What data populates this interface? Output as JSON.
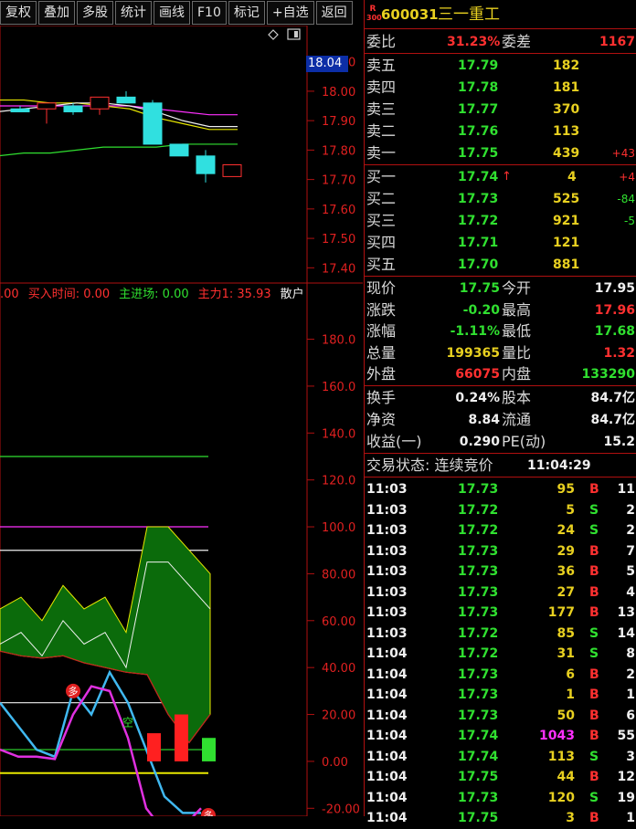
{
  "toolbar": {
    "buttons": [
      "复权",
      "叠加",
      "多股",
      "统计",
      "画线",
      "F10",
      "标记",
      "+自选",
      "返回"
    ]
  },
  "chart": {
    "price_axis": [
      "18.10",
      "18.00",
      "17.90",
      "17.80",
      "17.70",
      "17.60",
      "17.50",
      "17.40"
    ],
    "current_price_tag": "18.04",
    "indicator_axis": [
      "180.0",
      "160.0",
      "140.0",
      "120.0",
      "100.0",
      "80.00",
      "60.00",
      "40.00",
      "20.00",
      "0.00",
      "-20.00"
    ],
    "legend": [
      {
        "text": ".00",
        "color": "#ff3030"
      },
      {
        "text": "买入时间: 0.00",
        "color": "#ff3030"
      },
      {
        "text": "主进场: 0.00",
        "color": "#30e030"
      },
      {
        "text": "主力1: 35.93",
        "color": "#ff3030"
      },
      {
        "text": "散户",
        "color": "#f0f0f0"
      }
    ],
    "markers": {
      "duo": "多",
      "kong": "空"
    },
    "icons": [
      "diamond-icon",
      "window-icon"
    ]
  },
  "chart_data": {
    "type": "candlestick",
    "price_ylim": [
      17.37,
      18.13
    ],
    "candles": [
      {
        "open": 17.94,
        "close": 17.93,
        "high": 17.95,
        "low": 17.93,
        "color": "#30e0e0"
      },
      {
        "open": 17.94,
        "close": 17.96,
        "high": 17.96,
        "low": 17.89,
        "color": "#ff3030"
      },
      {
        "open": 17.95,
        "close": 17.93,
        "high": 17.96,
        "low": 17.92,
        "color": "#30e0e0"
      },
      {
        "open": 17.94,
        "close": 17.98,
        "high": 17.98,
        "low": 17.92,
        "color": "#ff3030"
      },
      {
        "open": 17.98,
        "close": 17.96,
        "high": 18.0,
        "low": 17.96,
        "color": "#30e0e0"
      },
      {
        "open": 17.96,
        "close": 17.82,
        "high": 17.97,
        "low": 17.82,
        "color": "#30e0e0"
      },
      {
        "open": 17.82,
        "close": 17.78,
        "high": 17.82,
        "low": 17.78,
        "color": "#30e0e0"
      },
      {
        "open": 17.78,
        "close": 17.72,
        "high": 17.8,
        "low": 17.69,
        "color": "#30e0e0"
      },
      {
        "open": 17.71,
        "close": 17.75,
        "high": 17.75,
        "low": 17.71,
        "color": "#ff3030"
      }
    ],
    "ma_lines": [
      {
        "color": "#ff30ff",
        "values": [
          17.95,
          17.95,
          17.95,
          17.95,
          17.95,
          17.95,
          17.94,
          17.93,
          17.92
        ]
      },
      {
        "color": "#e8e800",
        "values": [
          17.97,
          17.97,
          17.96,
          17.96,
          17.95,
          17.94,
          17.91,
          17.89,
          17.87
        ]
      },
      {
        "color": "#30e030",
        "values": [
          17.78,
          17.79,
          17.79,
          17.8,
          17.81,
          17.81,
          17.81,
          17.82,
          17.82
        ]
      },
      {
        "color": "#f0f0f0",
        "values": [
          17.93,
          17.94,
          17.95,
          17.96,
          17.96,
          17.95,
          17.93,
          17.9,
          17.88
        ]
      }
    ],
    "indicator_ylim": [
      -23,
      195
    ],
    "indicator_hlines": [
      {
        "value": 130,
        "color": "#30e030"
      },
      {
        "value": 100,
        "color": "#ff30ff"
      },
      {
        "value": 90,
        "color": "#f0f0f0"
      },
      {
        "value": 50,
        "color": "#e8e800"
      },
      {
        "value": 25,
        "color": "#f0f0f0"
      },
      {
        "value": 5,
        "color": "#30e030"
      },
      {
        "value": -5,
        "color": "#e8e800"
      }
    ],
    "area_upper": [
      65,
      70,
      60,
      75,
      65,
      70,
      55,
      100,
      100,
      90,
      80
    ],
    "area_lower": [
      47,
      45,
      44,
      45,
      42,
      40,
      38,
      37,
      20,
      8,
      20
    ],
    "cyan_line": [
      25,
      15,
      5,
      2,
      30,
      20,
      38,
      25,
      5,
      -15,
      -22,
      -22
    ],
    "magenta_line": [
      5,
      2,
      2,
      1,
      20,
      32,
      30,
      10,
      -20,
      -30,
      -28,
      -20
    ],
    "bars": [
      {
        "value": 12,
        "color": "#ff2020"
      },
      {
        "value": 20,
        "color": "#ff2020"
      },
      {
        "value": 10,
        "color": "#30e030"
      }
    ]
  },
  "quote": {
    "code": "600031",
    "name": "三一重工",
    "badge_top": "R",
    "badge_bottom": "300",
    "weibi_label": "委比",
    "weibi": "31.23%",
    "weicha_label": "委差",
    "weicha": "1167",
    "sells": [
      {
        "label": "卖五",
        "price": "17.79",
        "vol": "182",
        "chg": ""
      },
      {
        "label": "卖四",
        "price": "17.78",
        "vol": "181",
        "chg": ""
      },
      {
        "label": "卖三",
        "price": "17.77",
        "vol": "370",
        "chg": ""
      },
      {
        "label": "卖二",
        "price": "17.76",
        "vol": "113",
        "chg": ""
      },
      {
        "label": "卖一",
        "price": "17.75",
        "vol": "439",
        "chg": "+43"
      }
    ],
    "buys": [
      {
        "label": "买一",
        "price": "17.74",
        "vol": "4",
        "chg": "+4",
        "arrow": "↑"
      },
      {
        "label": "买二",
        "price": "17.73",
        "vol": "525",
        "chg": "-84",
        "arrow": ""
      },
      {
        "label": "买三",
        "price": "17.72",
        "vol": "921",
        "chg": "-5",
        "arrow": ""
      },
      {
        "label": "买四",
        "price": "17.71",
        "vol": "121",
        "chg": "",
        "arrow": ""
      },
      {
        "label": "买五",
        "price": "17.70",
        "vol": "881",
        "chg": "",
        "arrow": ""
      }
    ],
    "stats": [
      {
        "l1": "现价",
        "v1": "17.75",
        "c1": "grn",
        "l2": "今开",
        "v2": "17.95",
        "c2": "wht"
      },
      {
        "l1": "涨跌",
        "v1": "-0.20",
        "c1": "grn",
        "l2": "最高",
        "v2": "17.96",
        "c2": "red"
      },
      {
        "l1": "涨幅",
        "v1": "-1.11%",
        "c1": "grn",
        "l2": "最低",
        "v2": "17.68",
        "c2": "grn"
      },
      {
        "l1": "总量",
        "v1": "199365",
        "c1": "ylw",
        "l2": "量比",
        "v2": "1.32",
        "c2": "red"
      },
      {
        "l1": "外盘",
        "v1": "66075",
        "c1": "red",
        "l2": "内盘",
        "v2": "133290",
        "c2": "grn"
      }
    ],
    "fund": [
      {
        "l1": "换手",
        "v1": "0.24%",
        "l2": "股本",
        "v2": "84.7亿"
      },
      {
        "l1": "净资",
        "v1": "8.84",
        "l2": "流通",
        "v2": "84.7亿"
      },
      {
        "l1": "收益(一)",
        "v1": "0.290",
        "l2": "PE(动)",
        "v2": "15.2"
      }
    ],
    "status_label": "交易状态: 连续竞价",
    "status_time": "11:04:29"
  },
  "ticks": [
    {
      "t": "11:03",
      "p": "17.73",
      "v": "95",
      "s": "B",
      "n": "11"
    },
    {
      "t": "11:03",
      "p": "17.72",
      "v": "5",
      "s": "S",
      "n": "2"
    },
    {
      "t": "11:03",
      "p": "17.72",
      "v": "24",
      "s": "S",
      "n": "2"
    },
    {
      "t": "11:03",
      "p": "17.73",
      "v": "29",
      "s": "B",
      "n": "7"
    },
    {
      "t": "11:03",
      "p": "17.73",
      "v": "36",
      "s": "B",
      "n": "5"
    },
    {
      "t": "11:03",
      "p": "17.73",
      "v": "27",
      "s": "B",
      "n": "4"
    },
    {
      "t": "11:03",
      "p": "17.73",
      "v": "177",
      "s": "B",
      "n": "13"
    },
    {
      "t": "11:03",
      "p": "17.72",
      "v": "85",
      "s": "S",
      "n": "14"
    },
    {
      "t": "11:04",
      "p": "17.72",
      "v": "31",
      "s": "S",
      "n": "8"
    },
    {
      "t": "11:04",
      "p": "17.73",
      "v": "6",
      "s": "B",
      "n": "2"
    },
    {
      "t": "11:04",
      "p": "17.73",
      "v": "1",
      "s": "B",
      "n": "1"
    },
    {
      "t": "11:04",
      "p": "17.73",
      "v": "50",
      "s": "B",
      "n": "6"
    },
    {
      "t": "11:04",
      "p": "17.74",
      "v": "1043",
      "s": "B",
      "n": "55"
    },
    {
      "t": "11:04",
      "p": "17.74",
      "v": "113",
      "s": "S",
      "n": "3"
    },
    {
      "t": "11:04",
      "p": "17.75",
      "v": "44",
      "s": "B",
      "n": "12"
    },
    {
      "t": "11:04",
      "p": "17.73",
      "v": "120",
      "s": "S",
      "n": "19"
    },
    {
      "t": "11:04",
      "p": "17.75",
      "v": "3",
      "s": "B",
      "n": "1"
    }
  ]
}
